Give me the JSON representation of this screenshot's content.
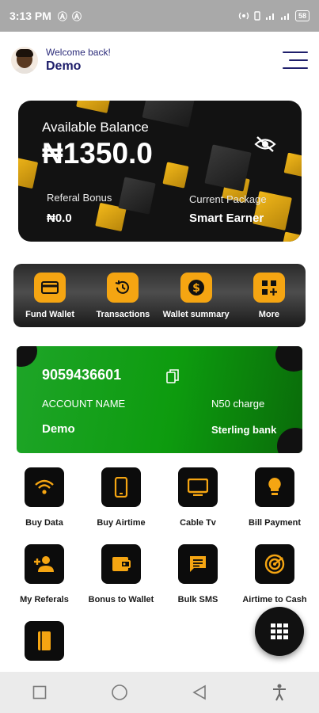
{
  "status_bar": {
    "time": "3:13 PM",
    "left_icons": [
      "Ⓐ",
      "Ⓐ"
    ],
    "battery": "58"
  },
  "header": {
    "welcome": "Welcome back!",
    "username": "Demo"
  },
  "balance_card": {
    "label": "Available Balance",
    "amount": "₦1350.0",
    "referral_label": "Referal Bonus",
    "referral_value": "₦0.0",
    "package_label": "Current Package",
    "package_value": "Smart Earner"
  },
  "quick_actions": [
    {
      "label": "Fund Wallet",
      "icon": "card-icon"
    },
    {
      "label": "Transactions",
      "icon": "history-icon"
    },
    {
      "label": "Wallet summary",
      "icon": "dollar-icon"
    },
    {
      "label": "More",
      "icon": "grid-plus-icon"
    }
  ],
  "account_card": {
    "account_number": "9059436601",
    "account_name_label": "ACCOUNT NAME",
    "charge": "N50 charge",
    "account_name": "Demo",
    "bank": "Sterling bank"
  },
  "services": [
    {
      "label": "Buy Data",
      "icon": "wifi-icon"
    },
    {
      "label": "Buy Airtime",
      "icon": "phone-icon"
    },
    {
      "label": "Cable Tv",
      "icon": "tv-icon"
    },
    {
      "label": "Bill Payment",
      "icon": "bulb-icon"
    },
    {
      "label": "My Referals",
      "icon": "person-add-icon"
    },
    {
      "label": "Bonus to Wallet",
      "icon": "wallet-icon"
    },
    {
      "label": "Bulk SMS",
      "icon": "message-icon"
    },
    {
      "label": "Airtime to Cash",
      "icon": "radar-icon"
    },
    {
      "label": "",
      "icon": "book-icon"
    }
  ],
  "colors": {
    "accent": "#f5a512",
    "dark": "#0c0c0c",
    "account_green": "#0d9b0e",
    "header_text": "#1e1e6b"
  }
}
